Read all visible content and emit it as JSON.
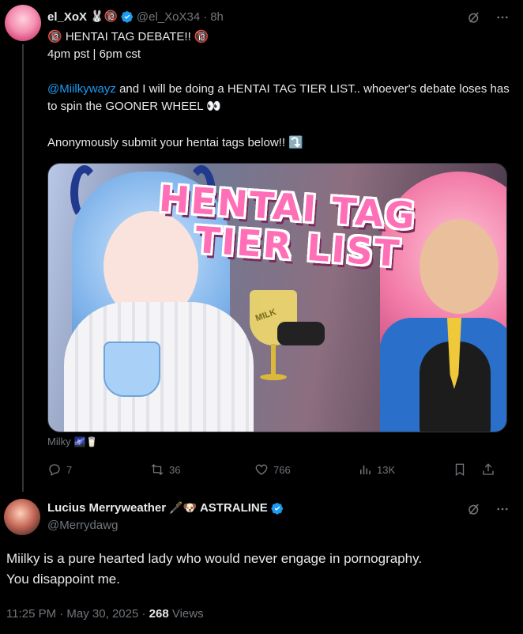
{
  "parent_tweet": {
    "display_name": "el_XoX",
    "name_emojis": "🐰🔞",
    "handle": "@el_XoX34",
    "time": "8h",
    "line1": "🔞 HENTAI TAG DEBATE!! 🔞",
    "line2": "4pm pst | 6pm cst",
    "mention": "@Miilkywayz",
    "body": " and I will be doing a HENTAI TAG TIER LIST.. whoever's debate loses has to spin the GOONER WHEEL 👀",
    "line4": "Anonymously submit your hentai tags below!! ⤵️",
    "media": {
      "title_line1": "HENTAI TAG",
      "title_line2": "TIER LIST",
      "glass_label": "MILK"
    },
    "caption": "Milky",
    "caption_emojis": "🌌🥛",
    "replies": "7",
    "reposts": "36",
    "likes": "766",
    "views": "13K"
  },
  "main_tweet": {
    "display_name": "Lucius Merryweather",
    "name_emojis": "🖋️🐶",
    "affiliation": "ASTRALINE",
    "handle": "@Merrydawg",
    "text_line1": "Miilky is a pure hearted lady who would never engage in pornography.",
    "text_line2": "You disappoint me.",
    "timestamp": "11:25 PM · May 30, 2025 · ",
    "view_count": "268",
    "views_label": " Views"
  },
  "colors": {
    "accent": "#1d9bf0",
    "muted": "#71767b",
    "text": "#e7e9ea",
    "background": "#000000"
  }
}
